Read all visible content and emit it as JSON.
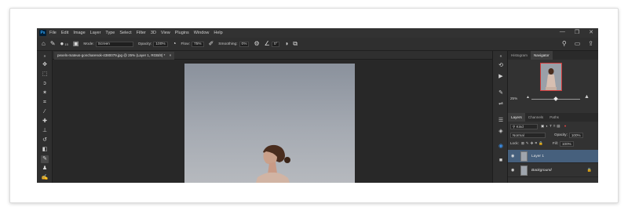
{
  "app": {
    "logo_text": "Ps",
    "menu": [
      "File",
      "Edit",
      "Image",
      "Layer",
      "Type",
      "Select",
      "Filter",
      "3D",
      "View",
      "Plugins",
      "Window",
      "Help"
    ],
    "window_controls": [
      "—",
      "❐",
      "✕"
    ]
  },
  "options": {
    "mode_label": "Mode:",
    "mode_value": "Screen",
    "opacity_label": "Opacity:",
    "opacity_value": "100%",
    "flow_label": "Flow:",
    "flow_value": "75%",
    "smoothing_label": "Smoothing:",
    "smoothing_value": "0%",
    "angle_value": "0°",
    "brush_size": "15"
  },
  "document": {
    "tab_title": "pexels-mateus-goncharenok-4380079.jpg @ 25% (Layer 1, RGB/8) *",
    "close_symbol": "×"
  },
  "panels": {
    "top_tabs": [
      "Histogram",
      "Navigator"
    ],
    "zoom_value": "25%",
    "layer_tabs": [
      "Layers",
      "Channels",
      "Paths"
    ],
    "kind_label": "Kind",
    "blend_mode": "Normal",
    "opacity_label": "Opacity:",
    "opacity_value": "100%",
    "lock_label": "Lock:",
    "fill_label": "Fill:",
    "fill_value": "100%",
    "layers": [
      {
        "name": "Layer 1",
        "selected": true
      },
      {
        "name": "Background",
        "selected": false
      }
    ]
  },
  "colors": {
    "accent": "#46607d",
    "canvas": "#282828",
    "ui": "#323232",
    "photo_bg": "#9aa1aa"
  }
}
